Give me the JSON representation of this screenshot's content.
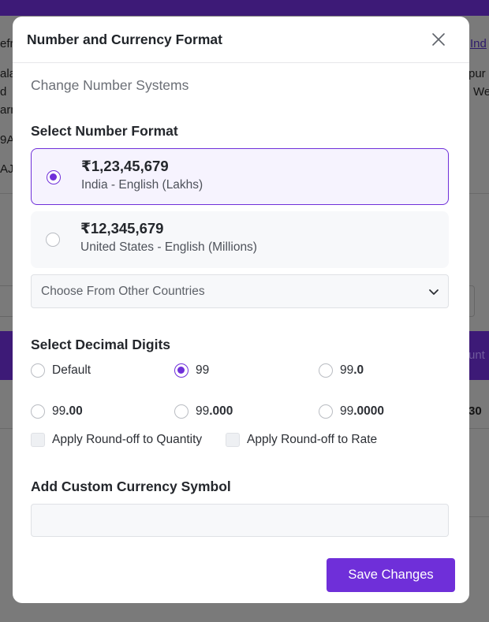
{
  "background": {
    "fragments": [
      "efro",
      "Ind",
      "ala",
      "pur",
      "d",
      "We",
      "arn",
      "9A",
      "AJ",
      "unt",
      "30"
    ]
  },
  "modal": {
    "title": "Number and Currency Format",
    "close_icon": "close-icon",
    "subtitle": "Change Number Systems",
    "number_format": {
      "heading": "Select Number Format",
      "options": [
        {
          "amount": "₹1,23,45,679",
          "locale": "India - English (Lakhs)",
          "selected": true
        },
        {
          "amount": "₹12,345,679",
          "locale": "United States - English (Millions)",
          "selected": false
        }
      ],
      "other_countries": {
        "label": "Choose From Other Countries",
        "icon": "chevron-down-icon"
      }
    },
    "decimal_digits": {
      "heading": "Select Decimal Digits",
      "options": [
        {
          "base": "Default",
          "suffix": "",
          "selected": false
        },
        {
          "base": "99",
          "suffix": "",
          "selected": true
        },
        {
          "base": "99",
          "suffix": ".0",
          "selected": false
        },
        {
          "base": "99",
          "suffix": ".00",
          "selected": false
        },
        {
          "base": "99",
          "suffix": ".000",
          "selected": false
        },
        {
          "base": "99",
          "suffix": ".0000",
          "selected": false
        }
      ]
    },
    "round_off": {
      "quantity_label": "Apply Round-off to Quantity",
      "rate_label": "Apply Round-off to Rate",
      "quantity_checked": false,
      "rate_checked": false
    },
    "custom_symbol": {
      "heading": "Add Custom Currency Symbol",
      "value": ""
    },
    "save_label": "Save Changes"
  },
  "colors": {
    "accent": "#6f2fd9",
    "header_bar": "#3d1a77",
    "overlay": "#7a7a7a"
  }
}
